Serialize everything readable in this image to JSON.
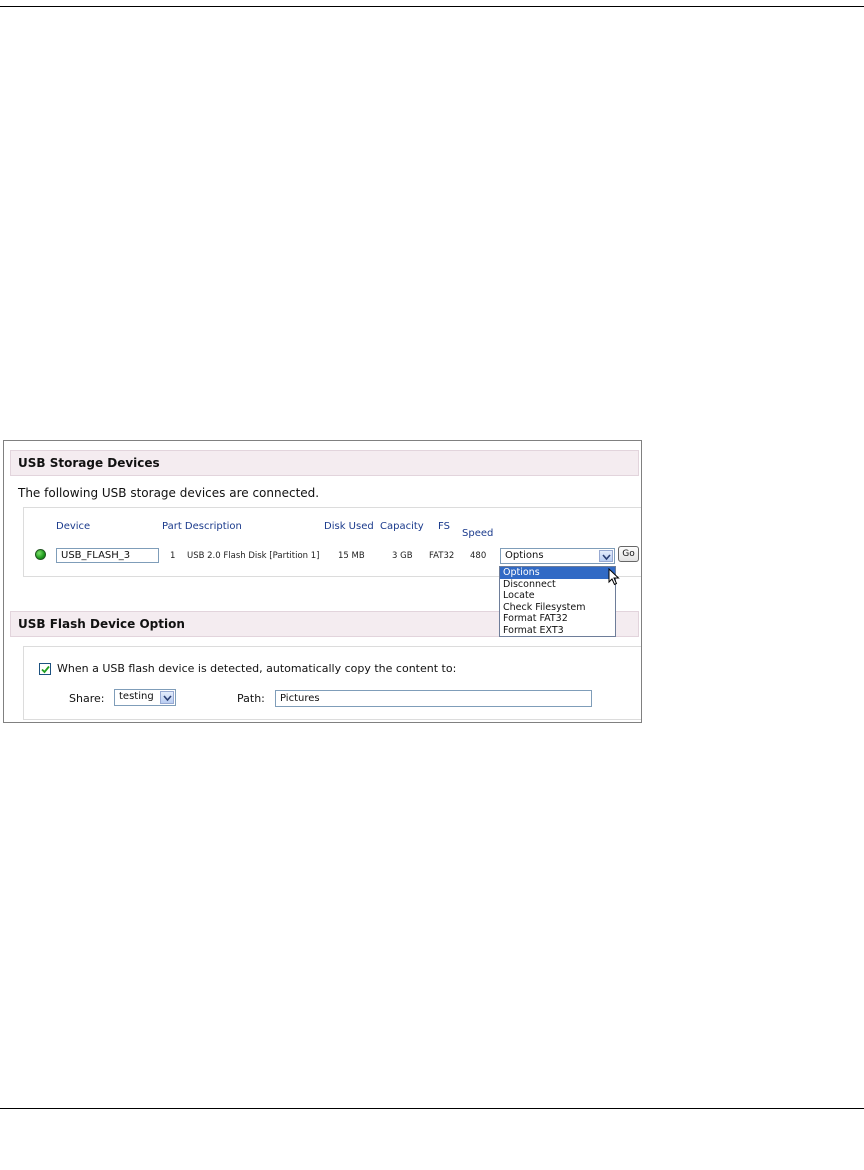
{
  "storage": {
    "title": "USB Storage Devices",
    "intro": "The following USB storage devices are connected.",
    "columns": {
      "device": "Device",
      "part_description": "Part Description",
      "disk_used": "Disk Used",
      "capacity": "Capacity",
      "fs": "FS",
      "speed": "Speed"
    },
    "row": {
      "device_name": "USB_FLASH_3",
      "part": "1",
      "description": "USB 2.0 Flash Disk [Partition 1]",
      "disk_used": "15 MB",
      "capacity": "3 GB",
      "fs": "FAT32",
      "speed": "480",
      "action_selected": "Options",
      "go_label": "Go",
      "status_color": "#22a022"
    },
    "action_options": [
      "Options",
      "Disconnect",
      "Locate",
      "Check Filesystem",
      "Format FAT32",
      "Format EXT3"
    ]
  },
  "flash_option": {
    "title": "USB Flash Device Option",
    "checked": true,
    "auto_copy_label": "When a USB flash device is detected, automatically copy the content to:",
    "share_label": "Share:",
    "share_value": "testing",
    "path_label": "Path:",
    "path_value": "Pictures"
  },
  "colors": {
    "header_bg": "#f4ecf0",
    "column_header_text": "#1a3a8c",
    "selection": "#316ac5"
  }
}
